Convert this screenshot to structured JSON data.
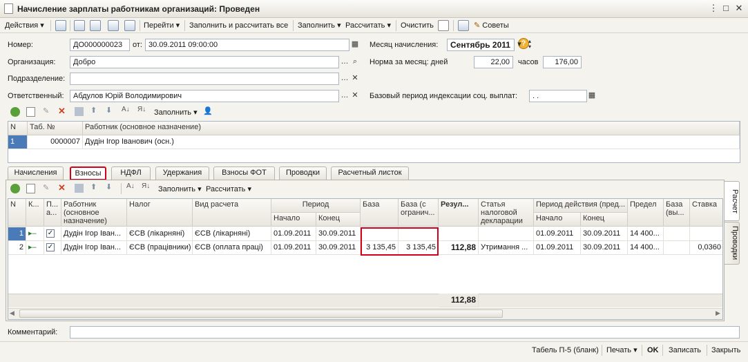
{
  "window": {
    "title": "Начисление зарплаты работникам организаций: Проведен"
  },
  "toolbar": {
    "actions": "Действия",
    "go": "Перейти",
    "fill_calc_all": "Заполнить и рассчитать все",
    "fill": "Заполнить",
    "calculate": "Рассчитать",
    "clear": "Очистить",
    "tips": "Советы"
  },
  "form": {
    "number_label": "Номер:",
    "number_value": "ДО000000023",
    "from_label": "от:",
    "date_value": "30.09.2011 09:00:00",
    "org_label": "Организация:",
    "org_value": "Добро",
    "dept_label": "Подразделение:",
    "dept_value": "",
    "resp_label": "Ответственный:",
    "resp_value": "Абдулов Юрій Володимирович",
    "month_label": "Месяц начисления:",
    "month_value": "Сентябрь 2011",
    "norm_label": "Норма за месяц: дней",
    "norm_days": "22,00",
    "hours_label": "часов",
    "norm_hours": "176,00",
    "base_period_label": "Базовый период индексации соц. выплат:",
    "base_period_value": " .  ."
  },
  "workers_toolbar": {
    "fill": "Заполнить"
  },
  "workers_table": {
    "headers": [
      "N",
      "Таб. №",
      "Работник (основное назначение)"
    ],
    "rows": [
      {
        "n": "1",
        "tab": "0000007",
        "name": "Дудін Ігор Іванович (осн.)"
      }
    ]
  },
  "tabs": [
    "Начисления",
    "Взносы",
    "НДФЛ",
    "Удержания",
    "Взносы ФОТ",
    "Проводки",
    "Расчетный листок"
  ],
  "side_tabs": [
    "Расчет",
    "Проводки"
  ],
  "contrib_toolbar": {
    "fill": "Заполнить",
    "calculate": "Рассчитать"
  },
  "contrib_table": {
    "headers": {
      "n": "N",
      "k": "К...",
      "p": "П... а...",
      "worker": "Работник (основное назначение)",
      "tax": "Налог",
      "calc_type": "Вид расчета",
      "period": "Период",
      "period_start": "Начало",
      "period_end": "Конец",
      "base": "База",
      "base_limited": "База (с огранич...",
      "result": "Резул...",
      "tax_item": "Статья налоговой декларации",
      "valid_period": "Период действия (пред...",
      "valid_start": "Начало",
      "valid_end": "Конец",
      "limit": "Предел",
      "base_excl": "База (вы...",
      "rate": "Ставка"
    },
    "rows": [
      {
        "n": "1",
        "worker": "Дудін Ігор Іван...",
        "tax": "ЄСВ (лікарняні)",
        "calc_type": "ЄСВ (лікарняні)",
        "start": "01.09.2011",
        "end": "30.09.2011",
        "base": "",
        "base_limited": "",
        "result": "",
        "tax_item": "",
        "vstart": "01.09.2011",
        "vend": "30.09.2011",
        "limit": "14 400...",
        "base_excl": "",
        "rate": ""
      },
      {
        "n": "2",
        "worker": "Дудін Ігор Іван...",
        "tax": "ЄСВ (працівники)",
        "calc_type": "ЄСВ (оплата праці)",
        "start": "01.09.2011",
        "end": "30.09.2011",
        "base": "3 135,45",
        "base_limited": "3 135,45",
        "result": "112,88",
        "tax_item": "Утримання ...",
        "vstart": "01.09.2011",
        "vend": "30.09.2011",
        "limit": "14 400...",
        "base_excl": "",
        "rate": "0,0360"
      }
    ],
    "total_result": "112,88"
  },
  "comment": {
    "label": "Комментарий:",
    "value": ""
  },
  "bottom": {
    "tabel": "Табель П-5 (бланк)",
    "print": "Печать",
    "ok": "OK",
    "save": "Записать",
    "close": "Закрыть"
  }
}
